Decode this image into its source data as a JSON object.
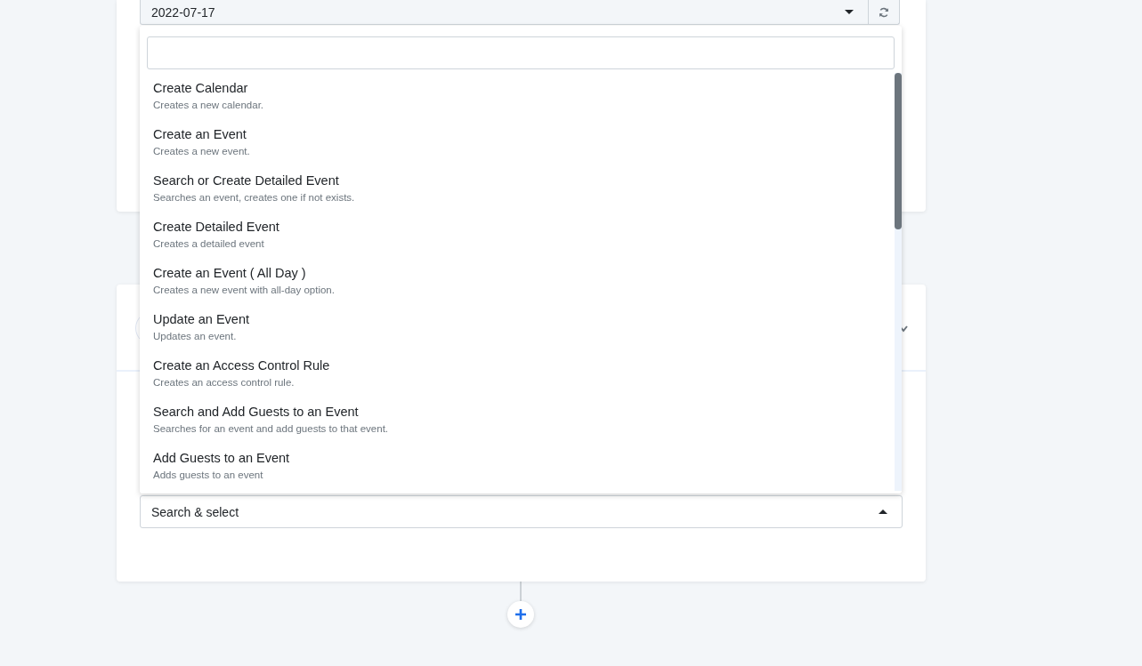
{
  "date_select": {
    "value": "2022-07-17",
    "expanded": false
  },
  "action_select": {
    "placeholder": "Search & select",
    "expanded": true
  },
  "options": [
    {
      "title": "Create Calendar",
      "description": "Creates a new calendar."
    },
    {
      "title": "Create an Event",
      "description": "Creates a new event."
    },
    {
      "title": "Search or Create Detailed Event",
      "description": "Searches an event, creates one if not exists."
    },
    {
      "title": "Create Detailed Event",
      "description": "Creates a detailed event"
    },
    {
      "title": "Create an Event ( All Day )",
      "description": "Creates a new event with all-day option."
    },
    {
      "title": "Update an Event",
      "description": "Updates an event."
    },
    {
      "title": "Create an Access Control Rule",
      "description": "Creates an access control rule."
    },
    {
      "title": "Search and Add Guests to an Event",
      "description": "Searches for an event and add guests to that event."
    },
    {
      "title": "Add Guests to an Event",
      "description": "Adds guests to an event"
    }
  ]
}
